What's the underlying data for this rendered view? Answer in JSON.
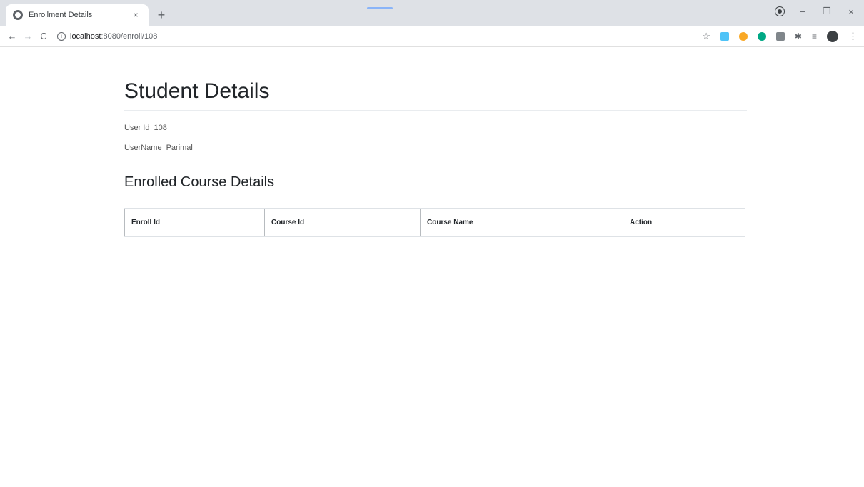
{
  "browser": {
    "tab_title": "Enrollment Details",
    "tab_close": "×",
    "new_tab": "+",
    "url_host": "localhost",
    "url_path": ":8080/enroll/108",
    "back": "←",
    "forward": "→",
    "reload": "C",
    "info": "i",
    "star": "☆",
    "minimize": "−",
    "maximize": "❐",
    "close": "×",
    "menu": "⋮",
    "avatar_letter": "",
    "extensions": [
      {
        "name": "extension-1-icon",
        "color": "#4fc3f7"
      },
      {
        "name": "extension-2-icon",
        "color": "#f9a825"
      },
      {
        "name": "extension-3-icon",
        "color": "#00a884"
      },
      {
        "name": "extension-4-icon",
        "color": "#80868b"
      }
    ]
  },
  "page": {
    "title": "Student Details",
    "user_id_label": "User Id",
    "user_id_value": "108",
    "username_label": "UserName",
    "username_value": "Parimal",
    "section_title": "Enrolled Course Details",
    "table": {
      "columns": [
        "Enroll Id",
        "Course Id",
        "Course Name",
        "Action"
      ],
      "rows": []
    }
  }
}
